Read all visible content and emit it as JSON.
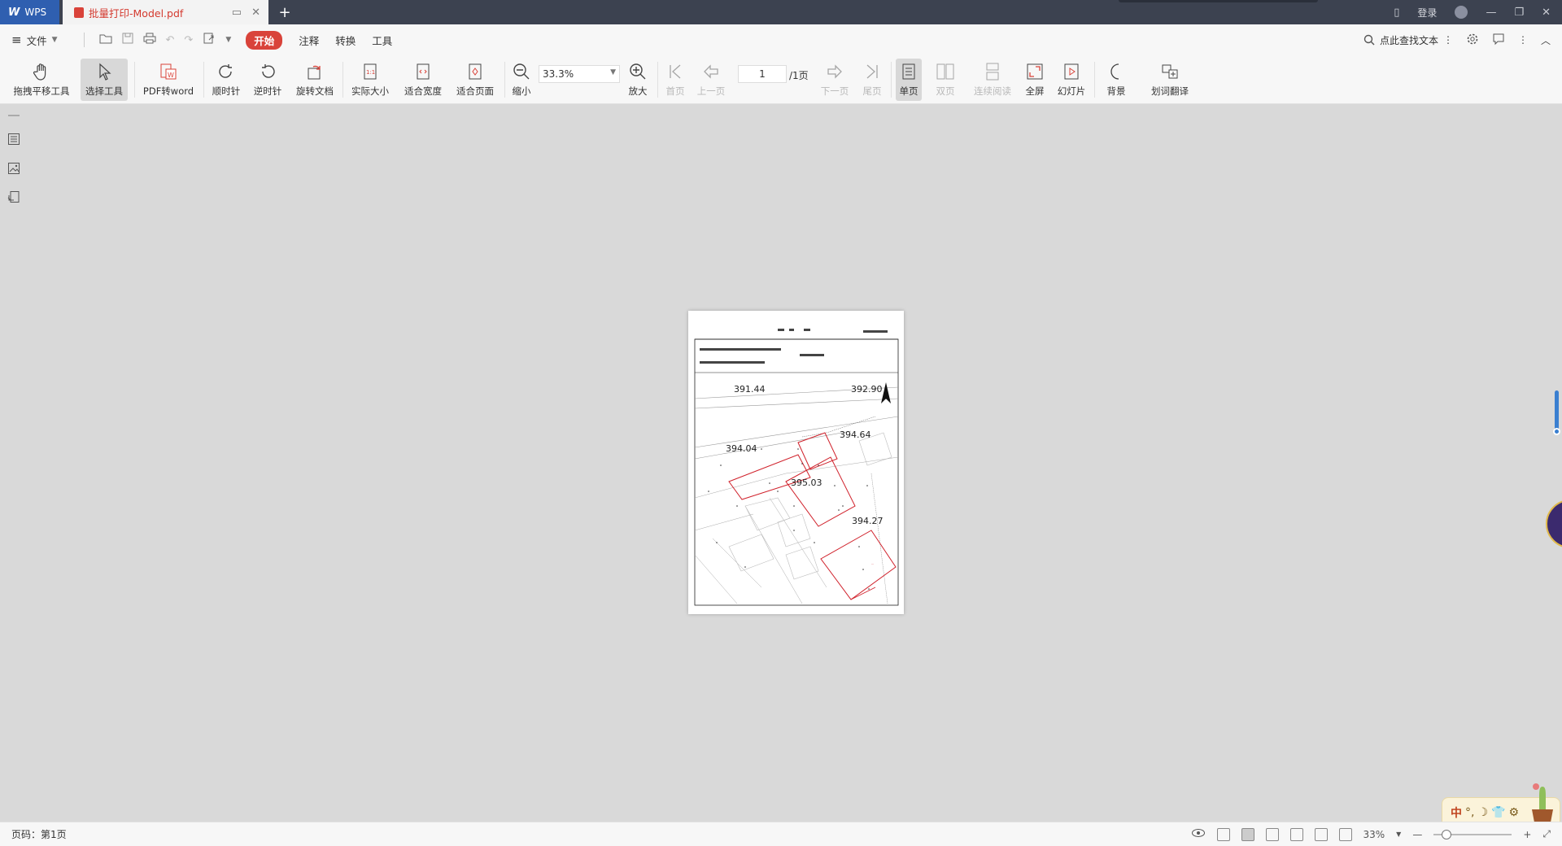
{
  "titlebar": {
    "app_tab": "WPS",
    "doc_tab": "批量打印-Model.pdf",
    "new_tab": "+",
    "login": "登录"
  },
  "menubar": {
    "file": "文件",
    "tabs": [
      "开始",
      "注释",
      "转换",
      "工具"
    ],
    "find": "点此查找文本"
  },
  "toolbar": {
    "pan": "拖拽平移工具",
    "select": "选择工具",
    "pdf2word": "PDF转word",
    "clockwise": "顺时针",
    "counterclockwise": "逆时针",
    "rotate": "旋转文档",
    "actual_size": "实际大小",
    "fit_width": "适合宽度",
    "fit_page": "适合页面",
    "zoom_out": "缩小",
    "zoom_value": "33.3%",
    "zoom_in": "放大",
    "first": "首页",
    "prev": "上一页",
    "page_value": "1",
    "page_total": "/1页",
    "next": "下一页",
    "last": "尾页",
    "single": "单页",
    "double": "双页",
    "continuous": "连续阅读",
    "fullscreen": "全屏",
    "slideshow": "幻灯片",
    "background": "背景",
    "translate": "划词翻译"
  },
  "document": {
    "elevations": [
      "391.44",
      "392.90",
      "394.64",
      "394.04",
      "395.03",
      "394.27"
    ]
  },
  "statusbar": {
    "page_info": "页码：第1页",
    "zoom": "33%"
  },
  "ime": {
    "lang": "中"
  }
}
